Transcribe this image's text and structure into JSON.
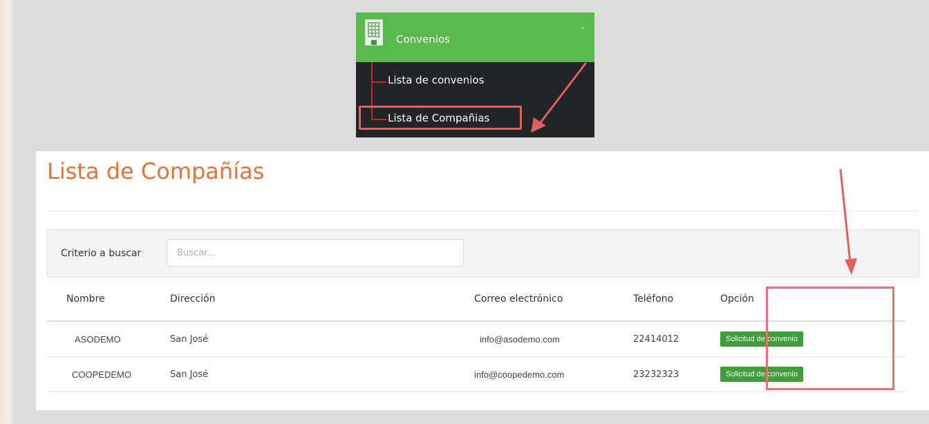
{
  "menu": {
    "title": "Convenios",
    "chevron_icon": "chevron-down-icon",
    "building_icon": "building-icon",
    "items": [
      {
        "label": "Lista de convenios"
      },
      {
        "label": "Lista de Compañias"
      }
    ],
    "colors": {
      "header": "#5ab94e",
      "body": "#222428",
      "highlight": "#e06060"
    }
  },
  "page": {
    "title": "Lista de Compañías",
    "title_color": "#e2733a"
  },
  "search": {
    "label": "Criterio a buscar",
    "placeholder": "Buscar...",
    "value": ""
  },
  "table": {
    "columns": [
      "Nombre",
      "Dirección",
      "Correo electrónico",
      "Teléfono",
      "Opción"
    ],
    "rows": [
      {
        "nombre": "ASODEMO",
        "direccion": "San José",
        "correo": "info@asodemo.com",
        "telefono": "22414012",
        "opcion": "Solicitud de convenio"
      },
      {
        "nombre": "COOPEDEMO",
        "direccion": "San José",
        "correo": "info@coopedemo.com",
        "telefono": "23232323",
        "opcion": "Solicitud de convenio"
      }
    ]
  },
  "colors": {
    "button": "#3f9d3a",
    "annotation": "#e06060"
  }
}
